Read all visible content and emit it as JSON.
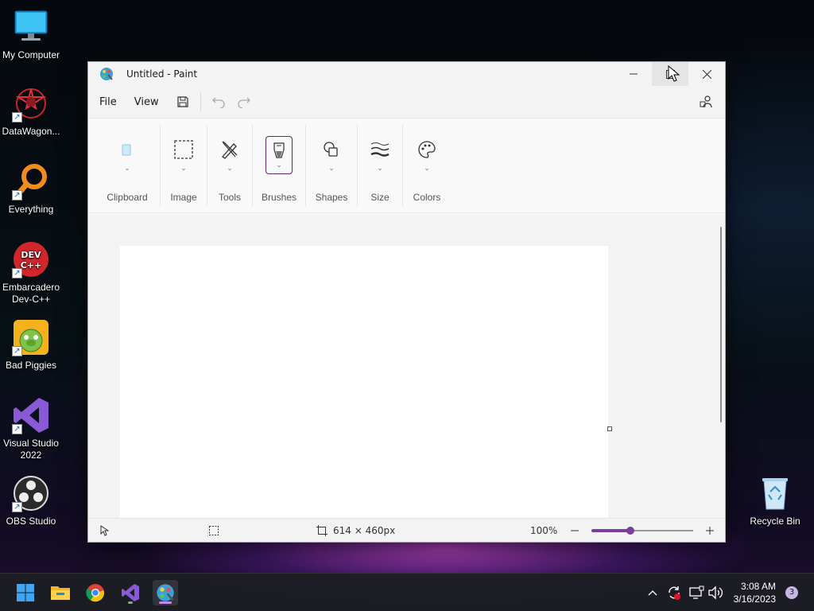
{
  "desktop": {
    "icons": [
      {
        "label": "My Computer"
      },
      {
        "label": "DataWagon..."
      },
      {
        "label": "Everything"
      },
      {
        "label": "Embarcadero Dev-C++"
      },
      {
        "label": "Bad Piggies"
      },
      {
        "label": "Visual Studio 2022"
      },
      {
        "label": "OBS Studio"
      },
      {
        "label": "Recycle Bin"
      }
    ]
  },
  "window": {
    "title": "Untitled - Paint",
    "menu": {
      "file": "File",
      "view": "View"
    },
    "ribbon": {
      "groups": [
        {
          "label": "Clipboard",
          "icon": "clipboard-icon"
        },
        {
          "label": "Image",
          "icon": "selection-icon"
        },
        {
          "label": "Tools",
          "icon": "pencil-icon"
        },
        {
          "label": "Brushes",
          "icon": "brush-icon"
        },
        {
          "label": "Shapes",
          "icon": "shapes-icon"
        },
        {
          "label": "Size",
          "icon": "size-icon"
        },
        {
          "label": "Colors",
          "icon": "palette-icon"
        }
      ]
    },
    "status": {
      "canvas_size": "614 × 460px",
      "zoom": "100%",
      "zoom_fraction": 0.38
    }
  },
  "taskbar": {
    "apps": [
      "start-icon",
      "file-explorer-icon",
      "chrome-icon",
      "visual-studio-icon",
      "paint-icon"
    ],
    "time": "3:08 AM",
    "date": "3/16/2023",
    "notifications": "3"
  },
  "colors": {
    "accent": "#7b3fa0",
    "window_bg": "#f9f9f9",
    "taskbar_bg": "#1c1e24"
  }
}
